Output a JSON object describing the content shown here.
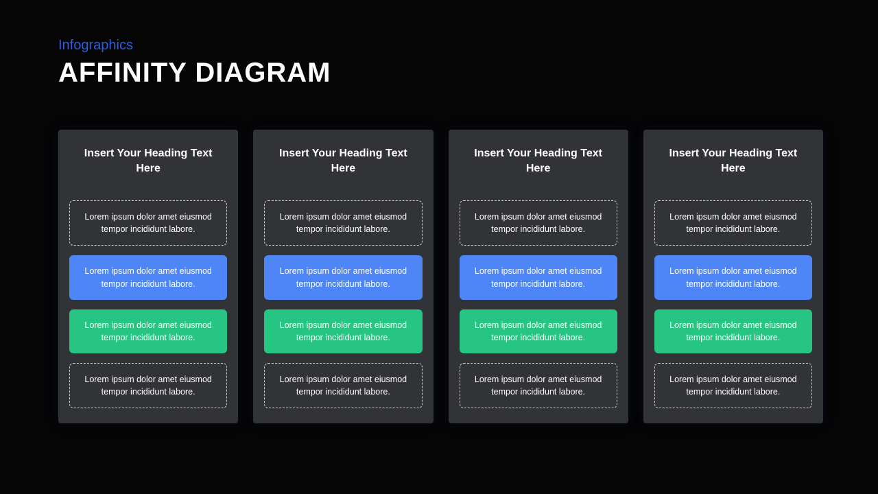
{
  "eyebrow": "Infographics",
  "title": "AFFINITY DIAGRAM",
  "colors": {
    "accent_link": "#2a5fe0",
    "card_blue": "#4f86f7",
    "card_green": "#27c584",
    "panel_bg": "#323336",
    "page_bg": "#050506"
  },
  "columns": [
    {
      "heading": "Insert Your Heading Text Here",
      "cards": [
        {
          "style": "dashed",
          "text": "Lorem ipsum dolor amet eiusmod tempor incididunt  labore."
        },
        {
          "style": "blue",
          "text": "Lorem ipsum dolor amet eiusmod tempor incididunt  labore."
        },
        {
          "style": "green",
          "text": "Lorem ipsum dolor amet eiusmod tempor incididunt  labore."
        },
        {
          "style": "dashed",
          "text": "Lorem ipsum dolor amet eiusmod tempor incididunt  labore."
        }
      ]
    },
    {
      "heading": "Insert Your Heading Text Here",
      "cards": [
        {
          "style": "dashed",
          "text": "Lorem ipsum dolor amet eiusmod tempor incididunt  labore."
        },
        {
          "style": "blue",
          "text": "Lorem ipsum dolor amet eiusmod tempor incididunt  labore."
        },
        {
          "style": "green",
          "text": "Lorem ipsum dolor amet eiusmod tempor incididunt  labore."
        },
        {
          "style": "dashed",
          "text": "Lorem ipsum dolor amet eiusmod tempor incididunt  labore."
        }
      ]
    },
    {
      "heading": "Insert Your Heading Text Here",
      "cards": [
        {
          "style": "dashed",
          "text": "Lorem ipsum dolor amet eiusmod tempor incididunt  labore."
        },
        {
          "style": "blue",
          "text": "Lorem ipsum dolor amet eiusmod tempor incididunt  labore."
        },
        {
          "style": "green",
          "text": "Lorem ipsum dolor amet eiusmod tempor incididunt  labore."
        },
        {
          "style": "dashed",
          "text": "Lorem ipsum dolor amet eiusmod tempor incididunt  labore."
        }
      ]
    },
    {
      "heading": "Insert Your Heading Text Here",
      "cards": [
        {
          "style": "dashed",
          "text": "Lorem ipsum dolor amet eiusmod tempor incididunt  labore."
        },
        {
          "style": "blue",
          "text": "Lorem ipsum dolor amet eiusmod tempor incididunt  labore."
        },
        {
          "style": "green",
          "text": "Lorem ipsum dolor amet eiusmod tempor incididunt  labore."
        },
        {
          "style": "dashed",
          "text": "Lorem ipsum dolor amet eiusmod tempor incididunt  labore."
        }
      ]
    }
  ]
}
